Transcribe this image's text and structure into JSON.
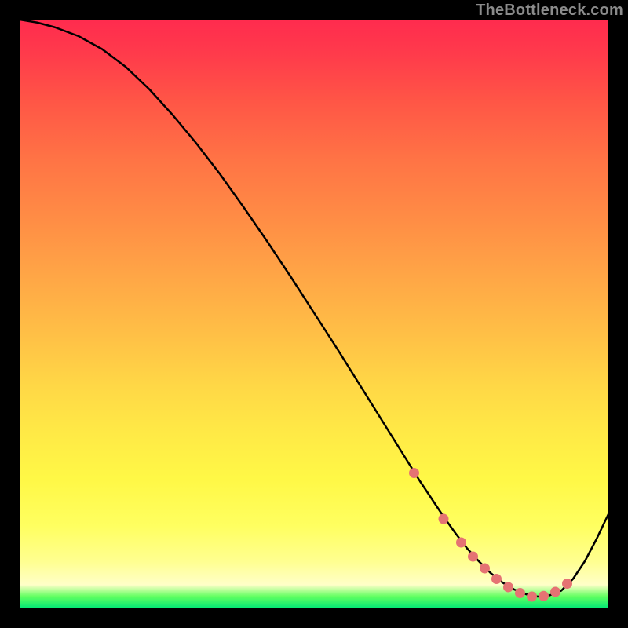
{
  "watermark": "TheBottleneck.com",
  "chart_data": {
    "type": "line",
    "title": "",
    "xlabel": "",
    "ylabel": "",
    "xlim": [
      0,
      100
    ],
    "ylim": [
      0,
      100
    ],
    "grid": false,
    "curve": {
      "name": "bottleneck-curve",
      "x": [
        0,
        3,
        6,
        10,
        14,
        18,
        22,
        26,
        30,
        34,
        38,
        42,
        46,
        50,
        54,
        58,
        62,
        66,
        68,
        70,
        72,
        74,
        76,
        78,
        80,
        82,
        84,
        86,
        88,
        90,
        92,
        94,
        96,
        98,
        100
      ],
      "y": [
        100,
        99.5,
        98.7,
        97.2,
        95.0,
        92.0,
        88.2,
        83.8,
        79.0,
        73.8,
        68.2,
        62.4,
        56.4,
        50.2,
        44.0,
        37.6,
        31.2,
        24.8,
        21.6,
        18.6,
        15.6,
        12.8,
        10.2,
        8.0,
        6.0,
        4.4,
        3.2,
        2.4,
        2.0,
        2.2,
        3.0,
        5.0,
        8.0,
        11.8,
        16.0
      ]
    },
    "highlight_dots": {
      "name": "valley-dots",
      "x": [
        67,
        72,
        75,
        77,
        79,
        81,
        83,
        85,
        87,
        89,
        91,
        93
      ],
      "y": [
        23.0,
        15.2,
        11.2,
        8.8,
        6.8,
        5.0,
        3.6,
        2.6,
        2.0,
        2.1,
        2.8,
        4.2
      ]
    },
    "colors": {
      "curve": "#000000",
      "dots": "#e57373",
      "gradient_top": "#ff2b4e",
      "gradient_bottom": "#00e876"
    }
  }
}
